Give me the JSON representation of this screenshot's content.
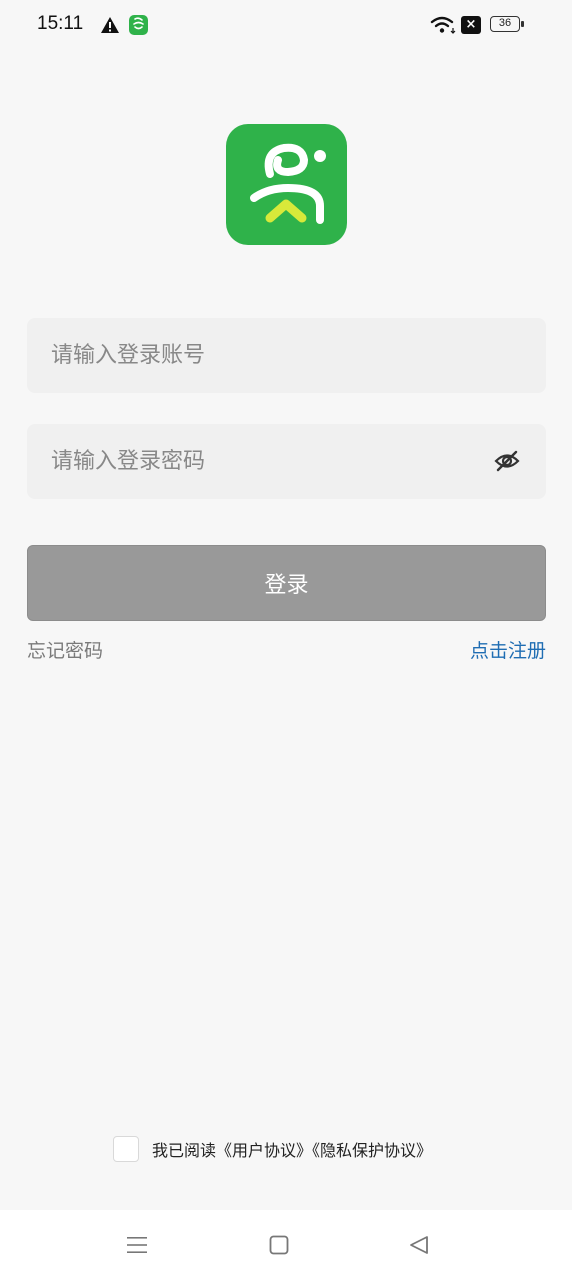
{
  "status_bar": {
    "time": "15:11",
    "sim_badge": "×",
    "battery": "36"
  },
  "login": {
    "account_placeholder": "请输入登录账号",
    "password_placeholder": "请输入登录密码",
    "login_button": "登录",
    "forgot_password": "忘记密码",
    "register": "点击注册"
  },
  "agreement": {
    "text": "我已阅读《用户协议》《隐私保护协议》",
    "checked": false
  },
  "colors": {
    "brand_green": "#2fb24a",
    "logo_accent": "#d8e93a",
    "link_blue": "#1f6db3",
    "button_gray": "#999999"
  },
  "icons": {
    "status": [
      "warning-icon",
      "app-notification-icon",
      "wifi-icon",
      "no-sim-icon",
      "battery-icon"
    ],
    "password_toggle": "eye-off-icon",
    "navigation": [
      "menu-icon",
      "home-icon",
      "back-icon"
    ]
  }
}
